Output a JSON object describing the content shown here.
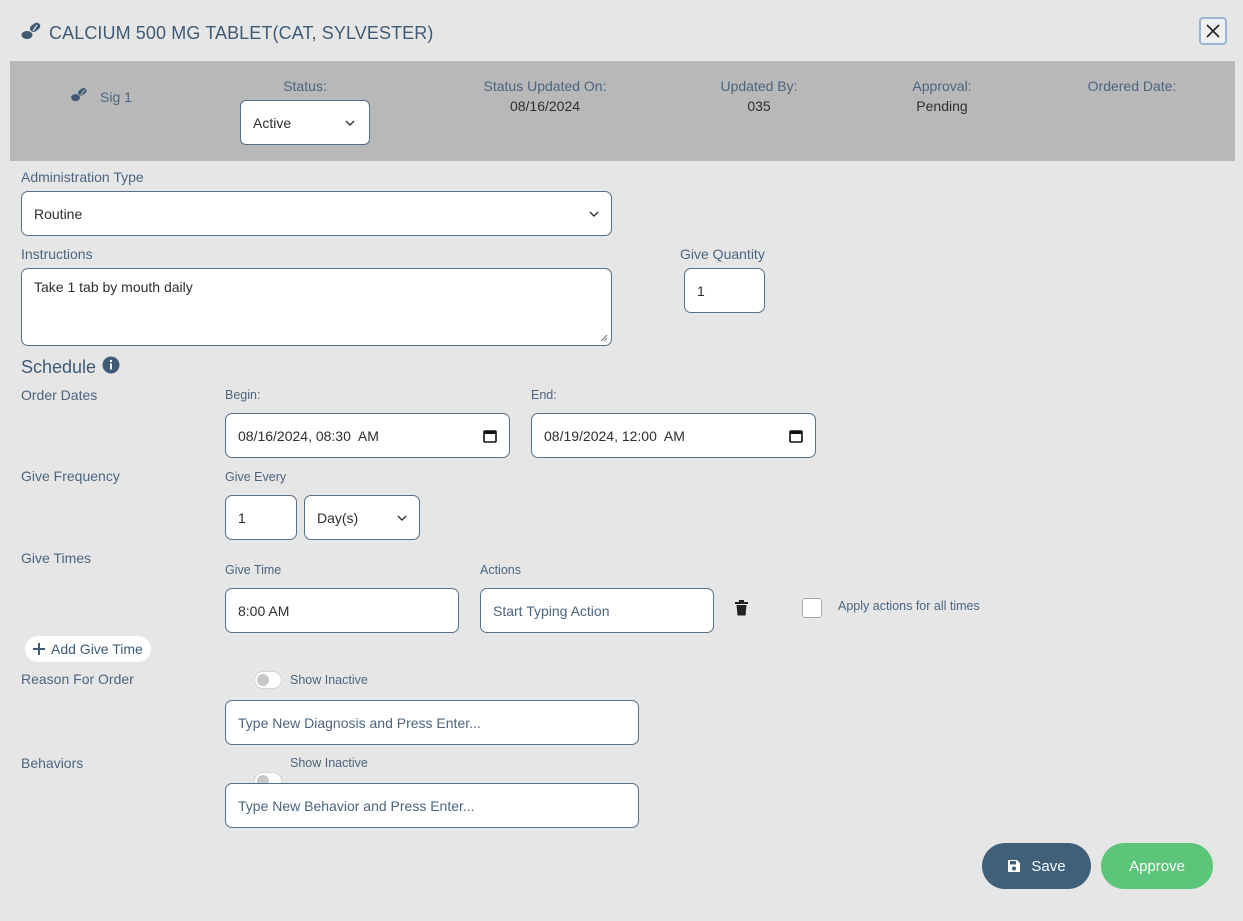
{
  "dialog": {
    "title": "CALCIUM 500 MG TABLET(CAT, SYLVESTER)"
  },
  "header": {
    "sig_label": "Sig 1",
    "status_label": "Status:",
    "status_value": "Active",
    "status_updated_label": "Status Updated On:",
    "status_updated_value": "08/16/2024",
    "updated_by_label": "Updated By:",
    "updated_by_value": "035",
    "approval_label": "Approval:",
    "approval_value": "Pending",
    "ordered_date_label": "Ordered Date:"
  },
  "administration": {
    "label": "Administration Type",
    "value": "Routine"
  },
  "instructions": {
    "label": "Instructions",
    "value": "Take 1 tab by mouth daily"
  },
  "give_quantity": {
    "label": "Give Quantity",
    "value": "1"
  },
  "schedule": {
    "title": "Schedule",
    "order_dates_label": "Order Dates",
    "begin_label": "Begin:",
    "begin_value": "08/16/2024, 08:30  AM",
    "end_label": "End:",
    "end_value": "08/19/2024, 12:00  AM",
    "give_frequency_label": "Give Frequency",
    "give_every_label": "Give Every",
    "give_every_value": "1",
    "give_every_unit": "Day(s)",
    "give_times_label": "Give Times",
    "give_time_label": "Give Time",
    "give_time_value": "8:00 AM",
    "actions_label": "Actions",
    "actions_placeholder": "Start Typing Action",
    "apply_all_label": "Apply actions for all times",
    "add_give_time_label": "Add Give Time"
  },
  "reason": {
    "label": "Reason For Order",
    "show_inactive_label": "Show Inactive",
    "placeholder": "Type New Diagnosis and Press Enter..."
  },
  "behaviors": {
    "label": "Behaviors",
    "show_inactive_label": "Show Inactive",
    "placeholder": "Type New Behavior and Press Enter..."
  },
  "footer": {
    "save_label": "Save",
    "approve_label": "Approve"
  },
  "colors": {
    "save": "#40607a",
    "approve": "#5cc579",
    "header_band": "#b8b8b8",
    "label": "#4b6580"
  }
}
